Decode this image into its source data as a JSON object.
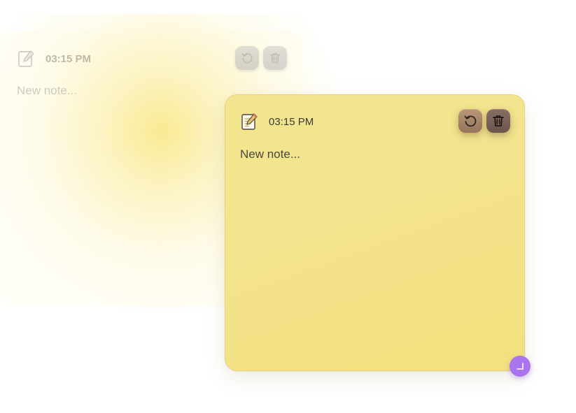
{
  "ghost_note": {
    "time": "03:15 PM",
    "placeholder": "New note...",
    "icons": {
      "note": "note-pencil-icon",
      "reset": "reset-icon",
      "delete": "trash-icon"
    }
  },
  "main_note": {
    "time": "03:15 PM",
    "placeholder": "New note...",
    "icons": {
      "note": "note-pencil-icon",
      "reset": "reset-icon",
      "delete": "trash-icon",
      "resize": "resize-handle-icon"
    }
  },
  "colors": {
    "note_background": "#f3e38d",
    "note_border": "#e6d37a",
    "reset_button": "#a88769",
    "delete_button": "#7a6358",
    "resize_handle": "#a974ee"
  }
}
